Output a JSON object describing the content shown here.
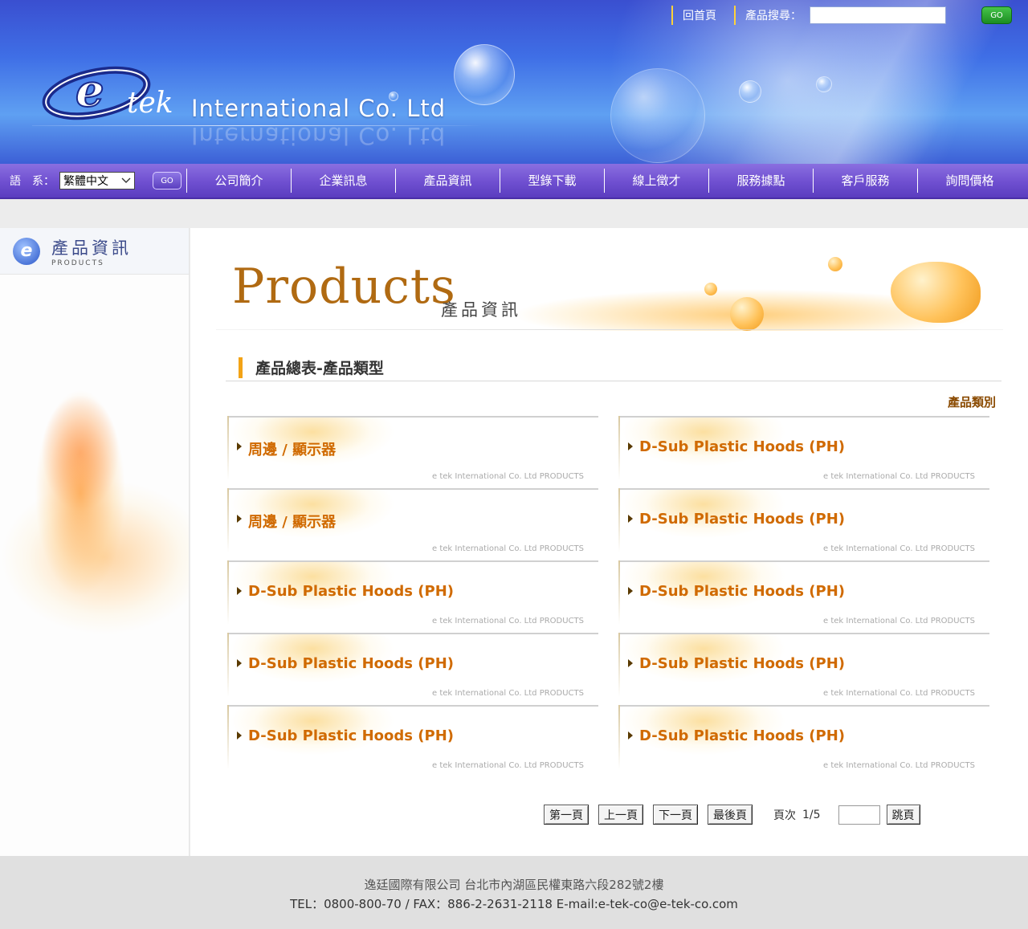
{
  "header": {
    "logo_mark": "tek",
    "logo_text": "International Co. Ltd",
    "links": [
      "回首頁"
    ],
    "search_label": "產品搜尋：",
    "search_value": "",
    "go_label": "GO"
  },
  "nav": {
    "lang_label": "語　系：",
    "lang_selected": "繁體中文",
    "go_label": "GO",
    "items": [
      "公司簡介",
      "企業訊息",
      "產品資訊",
      "型錄下載",
      "線上徵才",
      "服務據點",
      "客戶服務",
      "詢問價格"
    ]
  },
  "sidebar": {
    "logo_letter": "e",
    "title": "產品資訊",
    "subtitle": "PRODUCTS"
  },
  "banner": {
    "title": "Products",
    "subtitle": "產品資訊"
  },
  "section": {
    "title": "產品總表-產品類型",
    "category_label": "產品類別"
  },
  "cards": [
    {
      "title": "周邊 / 顯示器",
      "footer": "e tek International Co. Ltd PRODUCTS"
    },
    {
      "title": "D-Sub Plastic Hoods (PH)",
      "footer": "e tek International Co. Ltd PRODUCTS"
    },
    {
      "title": "周邊 / 顯示器",
      "footer": "e tek International Co. Ltd PRODUCTS"
    },
    {
      "title": "D-Sub Plastic Hoods (PH)",
      "footer": "e tek International Co. Ltd PRODUCTS"
    },
    {
      "title": "D-Sub Plastic Hoods (PH)",
      "footer": "e tek International Co. Ltd PRODUCTS"
    },
    {
      "title": "D-Sub Plastic Hoods (PH)",
      "footer": "e tek International Co. Ltd PRODUCTS"
    },
    {
      "title": "D-Sub Plastic Hoods (PH)",
      "footer": "e tek International Co. Ltd PRODUCTS"
    },
    {
      "title": "D-Sub Plastic Hoods (PH)",
      "footer": "e tek International Co. Ltd PRODUCTS"
    },
    {
      "title": "D-Sub Plastic Hoods (PH)",
      "footer": "e tek International Co. Ltd PRODUCTS"
    },
    {
      "title": "D-Sub Plastic Hoods (PH)",
      "footer": "e tek International Co. Ltd PRODUCTS"
    }
  ],
  "pager": {
    "first": "第一頁",
    "prev": "上一頁",
    "next": "下一頁",
    "last": "最後頁",
    "page_label": "頁次",
    "page_value": "1/5",
    "jump_value": "",
    "jump": "跳頁"
  },
  "footer": {
    "line1": "逸廷國際有限公司 台北市內湖區民權東路六段282號2樓",
    "line2": "TEL：0800-800-70 / FAX：886-2-2631-2118 E-mail:e-tek-co@e-tek-co.com"
  },
  "colors": {
    "header_blue": "#3f6fe6",
    "nav_purple": "#6f4fd0",
    "accent_orange": "#d06a00",
    "section_bar": "#f3a316"
  }
}
